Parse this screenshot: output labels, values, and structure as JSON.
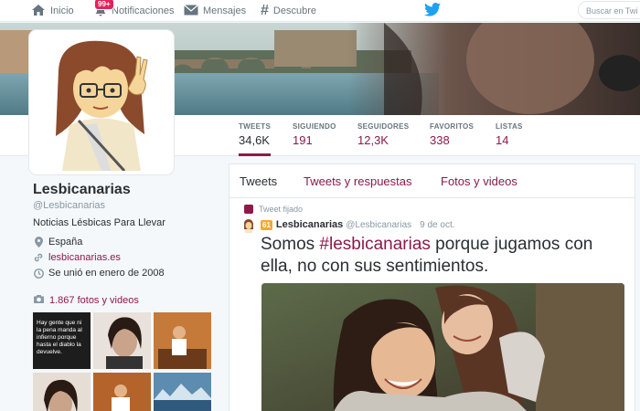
{
  "nav": {
    "home": "Inicio",
    "notifications": "Notificaciones",
    "notifications_badge": "99+",
    "messages": "Mensajes",
    "discover": "Descubre",
    "search_placeholder": "Buscar en Twi"
  },
  "stats": [
    {
      "label": "TWEETS",
      "value": "34,6K"
    },
    {
      "label": "SIGUIENDO",
      "value": "191"
    },
    {
      "label": "SEGUIDORES",
      "value": "12,3K"
    },
    {
      "label": "FAVORITOS",
      "value": "338"
    },
    {
      "label": "LISTAS",
      "value": "14"
    }
  ],
  "profile": {
    "name": "Lesbicanarias",
    "handle": "@Lesbicanarias",
    "bio": "Noticias Lésbicas Para Llevar",
    "location": "España",
    "url": "lesbicanarias.es",
    "joined": "Se unió en enero de 2008",
    "photos_link": "1.867 fotos y videos",
    "thumb_text": "Hay gente que ni la pena manda al infierno porque hasta el diablo la devuelve."
  },
  "timeline": {
    "tabs": [
      "Tweets",
      "Tweets y respuestas",
      "Fotos y videos"
    ],
    "pinned_label": "Tweet fijado",
    "tweet": {
      "badge": "61",
      "name": "Lesbicanarias",
      "handle": "@Lesbicanarias",
      "date": "9 de oct.",
      "text_before": "Somos ",
      "hashtag": "#lesbicanarias",
      "text_after": " porque jugamos con ella, no con sus sentimientos."
    }
  },
  "colors": {
    "accent": "#8b1a4a",
    "twitter_blue": "#1da1f2",
    "badge_red": "#e0245e"
  }
}
